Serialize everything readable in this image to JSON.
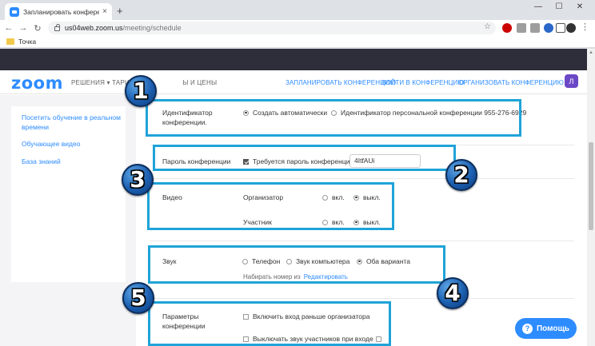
{
  "browser": {
    "tab_title": "Запланировать конференцию",
    "tab_close": "×",
    "new_tab": "+",
    "window_controls": [
      "—",
      "☐",
      "✕"
    ],
    "url_host": "us04web.zoom.us",
    "url_path": "/meeting/schedule",
    "bookmark": "Точка",
    "extension_colors": [
      "#cc0000",
      "#9e9e9e",
      "#9e9e9e",
      "#2a67c8",
      "#555555",
      "#333333"
    ]
  },
  "nav": {
    "logo": "zoom",
    "left_text": "РЕШЕНИЯ ▾  ТАРИФ",
    "left_text2": "Ы И ЦЕНЫ",
    "schedule": "ЗАПЛАНИРОВАТЬ КОНФЕРЕНЦИЮ",
    "join": "ВОЙТИ В КОНФЕРЕНЦИЮ",
    "host": "ОРГАНИЗОВАТЬ КОНФЕРЕНЦИЮ ▾",
    "avatar": "Л"
  },
  "sidebar": {
    "items": [
      {
        "label": "Посетить обучение в реальном времени"
      },
      {
        "label": "Обучающее видео"
      },
      {
        "label": "База знаний"
      }
    ]
  },
  "form": {
    "meeting_id": {
      "label": "Идентификатор конференции.",
      "auto": "Создать автоматически",
      "personal": "Идентификатор персональной конференции 955-276-6929"
    },
    "password": {
      "label": "Пароль конференции",
      "required": "Требуется пароль конференции",
      "value": "4ItfAUi"
    },
    "video": {
      "label": "Видео",
      "host_label": "Организатор",
      "participant_label": "Участник",
      "on": "вкл.",
      "off": "выкл."
    },
    "audio": {
      "label": "Звук",
      "phone": "Телефон",
      "computer": "Звук компьютера",
      "both": "Оба варианта",
      "dial_from": "Набирать номер из",
      "edit": "Редактировать"
    },
    "options": {
      "label": "Параметры конференции",
      "join_before_host": "Включить вход раньше организатора",
      "mute_on_entry": "Выключать звук участников при входе"
    }
  },
  "badges": [
    "1",
    "2",
    "3",
    "4",
    "5"
  ],
  "help": {
    "label": "Помощь",
    "icon": "?"
  },
  "colors": {
    "accent": "#2d8cff",
    "annotation": "#1fa3d8",
    "header_band": "#2d2e3a"
  }
}
